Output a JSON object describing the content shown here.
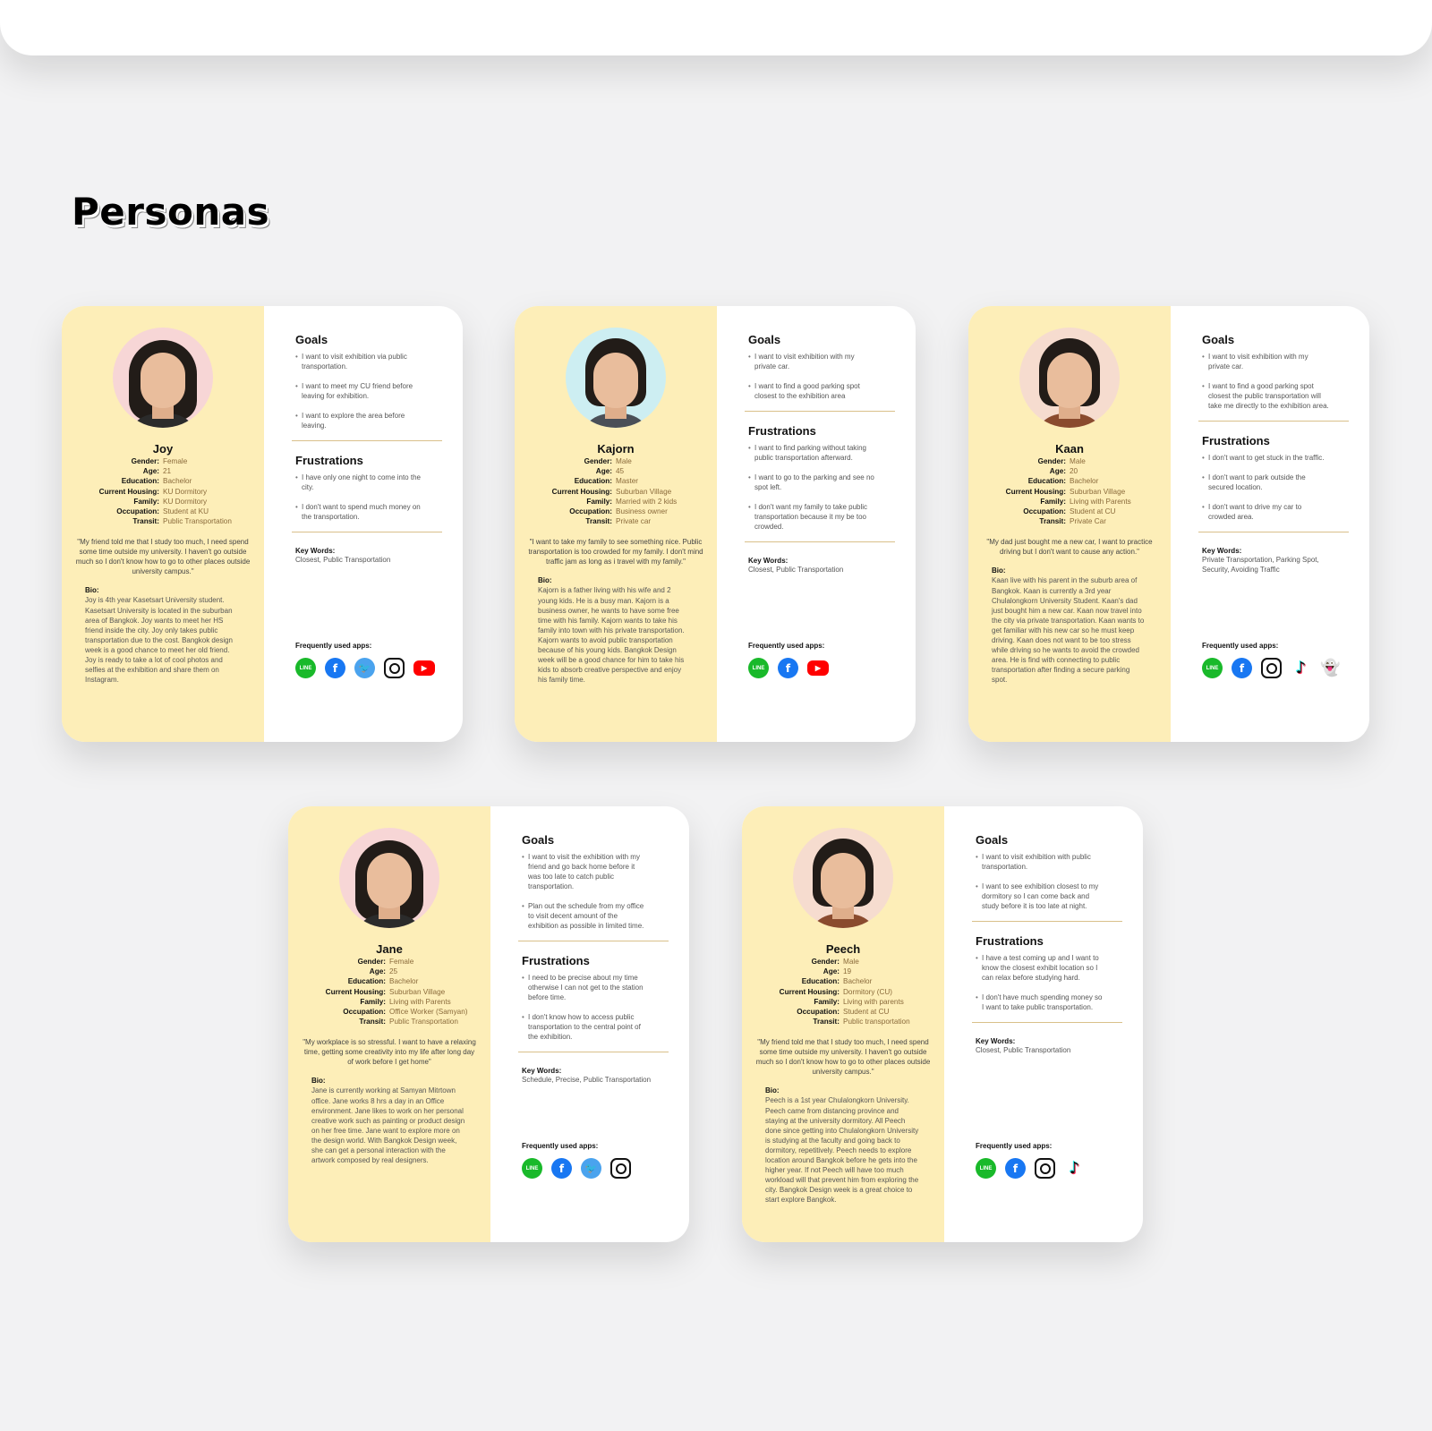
{
  "page": {
    "title": "Personas"
  },
  "labels": {
    "gender": "Gender:",
    "age": "Age:",
    "education": "Education:",
    "housing": "Current Housing:",
    "family": "Family:",
    "occupation": "Occupation:",
    "transit": "Transit:",
    "bio": "Bio:",
    "goals": "Goals",
    "frustrations": "Frustrations",
    "keywords": "Key Words:",
    "apps": "Frequently used apps:"
  },
  "personas": [
    {
      "name": "Joy",
      "gender": "Female",
      "age": "21",
      "education": "Bachelor",
      "housing": "KU Dormitory",
      "family": "KU Dormitory",
      "occupation": "Student at KU",
      "transit": "Public Transportation",
      "quote": "\"My friend told me that I study too much, I need spend some time outside my university. I haven't go outside much so I don't know how to go to other places outside university campus.\"",
      "bio": "Joy is 4th year Kasetsart University student. Kasetsart University is located in the suburban area of Bangkok. Joy wants to meet her HS friend inside the city. Joy only takes public transportation due to the cost. Bangkok design week is a good chance to meet her old friend. Joy is ready to take a lot of cool photos and selfies at the exhibition and share them on Instagram.",
      "goals": [
        "I want to visit exhibition via public transportation.",
        "I want to meet my CU friend before leaving for exhibition.",
        "I want to explore the area before leaving."
      ],
      "frustrations": [
        "I have only one night to come into the city.",
        "I don't want to spend much money on the transportation."
      ],
      "keywords": "Closest, Public Transportation",
      "apps": [
        "line-icon",
        "facebook-icon",
        "twitter-icon",
        "instagram-icon",
        "youtube-icon"
      ]
    },
    {
      "name": "Kajorn",
      "gender": "Male",
      "age": "45",
      "education": "Master",
      "housing": "Suburban Village",
      "family": "Married with 2 kids",
      "occupation": "Business owner",
      "transit": "Private car",
      "quote": "\"I want to take my family to see something nice. Public transportation is too crowded for my family. I don't mind traffic jam as long as i travel with my family.\"",
      "bio": "Kajorn is a father living with his wife and 2 young kids. He is a busy man. Kajorn is a business owner, he wants to have some free time with his family. Kajorn wants to take his family into town with his private transportation. Kajorn wants to avoid public transportation because of his young kids. Bangkok Design week will be a good chance for him to take his kids to absorb creative perspective and enjoy his family time.",
      "goals": [
        "I want to visit exhibition with my private car.",
        "I want to find  a good parking spot closest to the exhibition area"
      ],
      "frustrations": [
        "I want to find parking without taking public transportation afterward.",
        "I want to go to the parking and see no spot left.",
        "I don't want my family to take public transportation because it my be too crowded."
      ],
      "keywords": "Closest, Public Transportation",
      "apps": [
        "line-icon",
        "facebook-icon",
        "youtube-icon"
      ]
    },
    {
      "name": "Kaan",
      "gender": "Male",
      "age": "20",
      "education": "Bachelor",
      "housing": "Suburban Village",
      "family": "Living with Parents",
      "occupation": "Student at CU",
      "transit": "Private Car",
      "quote": "\"My dad just bought me a new car, I want to practice driving but I don't want to cause any action.\"",
      "bio": "Kaan live with his parent in the suburb area of Bangkok. Kaan is currently a 3rd year Chulalongkorn University Student. Kaan's dad just bought him a new car. Kaan now travel into the city via private transportation. Kaan wants to get familiar with his new car so he must keep driving. Kaan does not want to be too stress while driving so he wants to avoid the crowded area. He is find with connecting to public transportation after finding a secure parking spot.",
      "goals": [
        "I want to visit exhibition with my private car.",
        "I want to find  a good parking spot closest the public transportation will take me directly to the exhibition area."
      ],
      "frustrations": [
        "I don't want to get stuck in the traffic.",
        "I don't want to park outside the secured location.",
        "I don't want to drive my car to crowded area."
      ],
      "keywords": "Private Transportation, Parking Spot, Security, Avoiding Traffic",
      "apps": [
        "line-icon",
        "facebook-icon",
        "instagram-icon",
        "tiktok-icon",
        "snapchat-icon"
      ]
    },
    {
      "name": "Jane",
      "gender": "Female",
      "age": "25",
      "education": "Bachelor",
      "housing": "Suburban Village",
      "family": "Living with Parents",
      "occupation": "Office Worker (Samyan)",
      "transit": "Public Transportation",
      "quote": "\"My workplace is so stressful. I want to have a relaxing time, getting some creativity into my life after long day of work before I get home\"",
      "bio": "Jane is currently working at Samyan Mitrtown office. Jane works 8 hrs a day in an Office environment. Jane likes to work on her personal creative work such as painting or product design on her free time. Jane want to explore more on the design world. With Bangkok Design week, she can get a personal interaction with the artwork composed by real designers.",
      "goals": [
        "I want to visit the exhibition with my friend and go back home before it was too late to catch public transportation.",
        "Plan out the schedule from my office to visit decent amount of the exhibition as possible in limited time."
      ],
      "frustrations": [
        "I need to be precise about my time otherwise I can not get to the station before time.",
        "I don't know how to access public transportation to the central point of the exhibition."
      ],
      "keywords": "Schedule, Precise, Public Transportation",
      "apps": [
        "line-icon",
        "facebook-icon",
        "twitter-icon",
        "instagram-icon"
      ]
    },
    {
      "name": "Peech",
      "gender": "Male",
      "age": "19",
      "education": "Bachelor",
      "housing": "Dormitory (CU)",
      "family": "Living with parents",
      "occupation": "Student at CU",
      "transit": "Public transportation",
      "quote": "\"My friend told me that I study too much, I need spend some time outside my university. I haven't go outside much so I don't know how to go to other places outside university campus.\"",
      "bio": "Peech is a 1st year Chulalongkorn University. Peech came from distancing province and staying at the university dormitory. All Peech done since getting into Chulalongkorn University is studying at the faculty and going back to dormitory, repetitively. Peech needs to explore location around Bangkok before he gets into the higher year. If not Peech will have too much workload will that prevent him from exploring the city. Bangkok Design week is a great choice to start explore Bangkok.",
      "goals": [
        "I want to visit exhibition with public transportation.",
        "I want to see exhibition closest to my dormitory so I can come back and study before it is too late at night."
      ],
      "frustrations": [
        "I have a test coming up and I want to know the closest exhibit location so I can relax before studying hard.",
        "I don't have much spending money so I want to take public transportation."
      ],
      "keywords": "Closest, Public Transportation",
      "apps": [
        "line-icon",
        "facebook-icon",
        "instagram-icon",
        "tiktok-icon"
      ]
    }
  ],
  "app_glyphs": {
    "line-icon": "LINE",
    "facebook-icon": "f",
    "twitter-icon": "🐦",
    "instagram-icon": "",
    "youtube-icon": "▶",
    "tiktok-icon": "♪",
    "snapchat-icon": "👻"
  },
  "colors": {
    "card_left": "#fdeeb8",
    "divider": "#d9c08a",
    "background": "#f2f2f3"
  }
}
